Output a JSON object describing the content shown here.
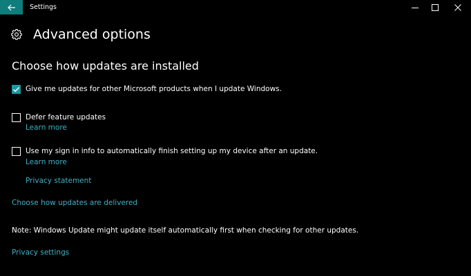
{
  "titlebar": {
    "title": "Settings",
    "back_icon": "back-arrow-icon",
    "accent": "#0f7d7b"
  },
  "header": {
    "icon": "gear-icon",
    "title": "Advanced options"
  },
  "section": {
    "title": "Choose how updates are installed"
  },
  "options": [
    {
      "label": "Give me updates for other Microsoft products when I update Windows.",
      "checked": true
    },
    {
      "label": "Defer feature updates",
      "checked": false,
      "link": "Learn more"
    },
    {
      "label": "Use my sign in info to automatically finish setting up my device after an update.",
      "checked": false,
      "link": "Learn more"
    }
  ],
  "links": {
    "privacy_statement": "Privacy statement",
    "delivery": "Choose how updates are delivered",
    "privacy_settings": "Privacy settings"
  },
  "note": "Note: Windows Update might update itself automatically first when checking for other updates.",
  "colors": {
    "background": "#000000",
    "link": "#3fb1c6",
    "checkbox_checked": "#1a9aa0"
  }
}
